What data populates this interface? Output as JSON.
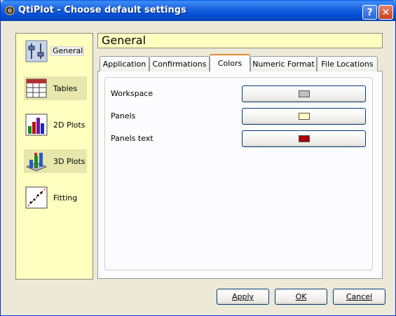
{
  "window": {
    "title": "QtiPlot - Choose default settings",
    "help_label": "?",
    "close_label": "✕"
  },
  "sidebar": {
    "items": [
      {
        "label": "General",
        "icon": "general-settings-icon"
      },
      {
        "label": "Tables",
        "icon": "table-icon"
      },
      {
        "label": "2D Plots",
        "icon": "bar-chart-icon"
      },
      {
        "label": "3D Plots",
        "icon": "3d-bar-chart-icon"
      },
      {
        "label": "Fitting",
        "icon": "fitting-icon"
      }
    ],
    "selected": "General"
  },
  "header": {
    "title": "General"
  },
  "tabs": [
    {
      "label": "Application"
    },
    {
      "label": "Confirmations"
    },
    {
      "label": "Colors"
    },
    {
      "label": "Numeric Format"
    },
    {
      "label": "File Locations"
    }
  ],
  "active_tab": "Colors",
  "colors": {
    "rows": [
      {
        "label": "Workspace",
        "color": "#c0c0c0"
      },
      {
        "label": "Panels",
        "color": "#ffffc0"
      },
      {
        "label": "Panels text",
        "color": "#aa0000"
      }
    ]
  },
  "buttons": {
    "apply": "Apply",
    "ok": "OK",
    "cancel": "Cancel"
  }
}
